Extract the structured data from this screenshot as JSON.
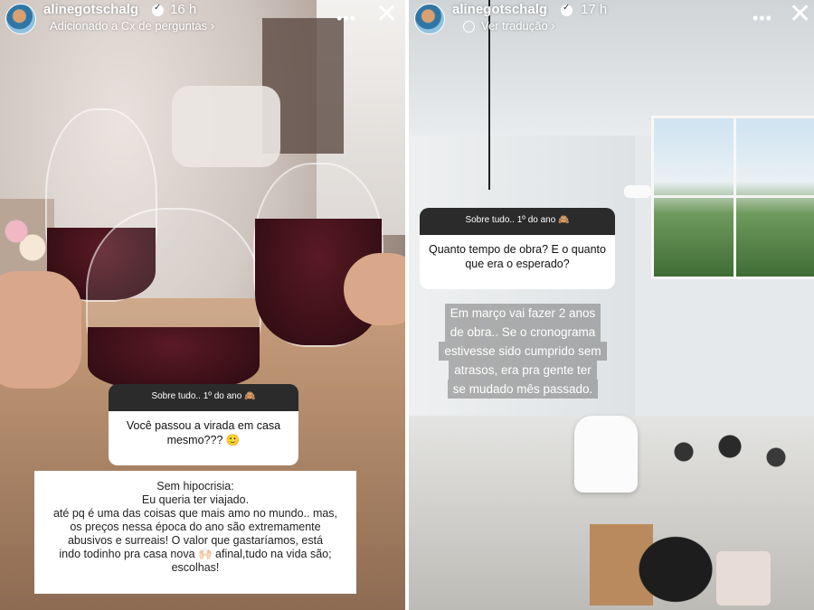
{
  "stories": [
    {
      "header": {
        "username": "alinegotschalg",
        "time": "16 h",
        "subtitle": "Adicionado a Cx de perguntas ›",
        "more_label": "•••",
        "close_label": "✕"
      },
      "question": {
        "header": "Sobre tudo.. 1º do ano 🙈",
        "text": "Você passou a virada em casa mesmo??? 🙂"
      },
      "answer": {
        "lines": [
          "Sem hipocrisia:",
          "Eu queria ter viajado.",
          "até pq é uma das coisas que mais amo no mundo.. mas,",
          "os preços nessa época do ano são extremamente",
          "abusivos e surreais! O valor que gastaríamos, está",
          "indo todinho pra casa nova 🙌🏻 afinal,tudo na vida são;",
          "escolhas!"
        ]
      }
    },
    {
      "header": {
        "username": "alinegotschalg",
        "time": "17 h",
        "subtitle": "Ver tradução ›",
        "more_label": "•••",
        "close_label": "✕"
      },
      "question": {
        "header": "Sobre tudo.. 1º do ano 🙈",
        "text": "Quanto tempo de obra? E o quanto que era o esperado?"
      },
      "answer": {
        "lines": [
          "Em março vai fazer 2 anos",
          "de obra.. Se o cronograma",
          "estivesse sido cumprido sem",
          "atrasos, era pra gente ter",
          "se mudado mês passado."
        ]
      }
    }
  ],
  "icons": {
    "more": "more-icon",
    "close": "close-icon",
    "verified": "verified-icon",
    "globe": "globe-icon"
  },
  "colors": {
    "question_header_bg": "#2b2b2b",
    "question_body_bg": "#ffffff",
    "answer_highlight": "#787878"
  }
}
